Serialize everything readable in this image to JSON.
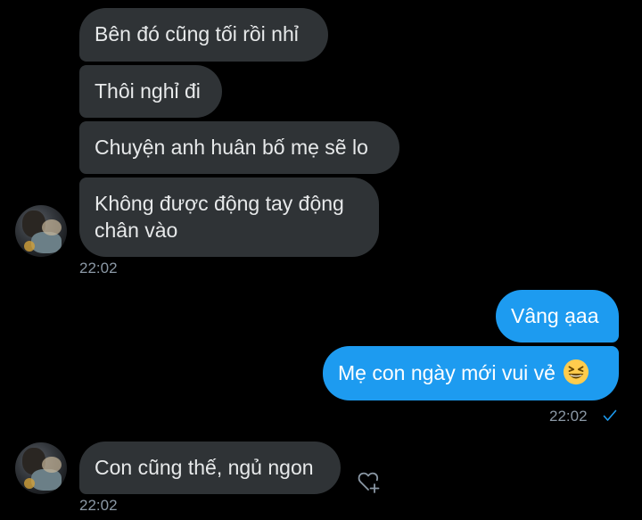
{
  "conversation": {
    "group1": {
      "messages": [
        "Bên đó cũng tối rồi nhỉ",
        "Thôi nghỉ đi",
        "Chuyện anh huân bố mẹ sẽ lo",
        "Không được động tay động chân vào"
      ],
      "time": "22:02"
    },
    "outgoing": {
      "messages": [
        "Vâng ạaa",
        "Mẹ con ngày mới vui vẻ"
      ],
      "emoji": "grinning-squinting-face",
      "time": "22:02",
      "status": "sent-check"
    },
    "group2": {
      "messages": [
        "Con cũng thế, ngủ ngon"
      ],
      "time": "22:02"
    }
  },
  "colors": {
    "background": "#000000",
    "incoming_bubble": "#2f3336",
    "outgoing_bubble": "#1d9bf0",
    "timestamp": "#8b98a5"
  }
}
